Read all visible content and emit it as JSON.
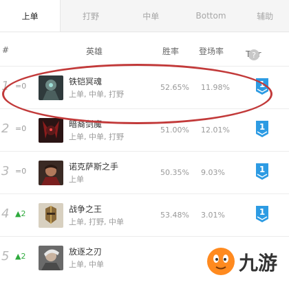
{
  "tabs": [
    {
      "label": "上单",
      "active": true
    },
    {
      "label": "打野",
      "active": false
    },
    {
      "label": "中单",
      "active": false
    },
    {
      "label": "Bottom",
      "active": false
    },
    {
      "label": "辅助",
      "active": false
    }
  ],
  "header": {
    "rank": "#",
    "hero": "英雄",
    "win": "胜率",
    "play": "登场率",
    "tier": "Tier",
    "help": "?"
  },
  "rows": [
    {
      "rank": "1",
      "change": "=0",
      "change_dir": "same",
      "name": "铁铠冥魂",
      "roles": "上单, 中单, 打野",
      "win": "52.65%",
      "play": "11.98%",
      "tier": "1"
    },
    {
      "rank": "2",
      "change": "=0",
      "change_dir": "same",
      "name": "暗裔剑魔",
      "roles": "上单, 中单, 打野",
      "win": "51.00%",
      "play": "12.01%",
      "tier": "1"
    },
    {
      "rank": "3",
      "change": "=0",
      "change_dir": "same",
      "name": "诺克萨斯之手",
      "roles": "上单",
      "win": "50.35%",
      "play": "9.03%",
      "tier": "1"
    },
    {
      "rank": "4",
      "change": "▲2",
      "change_dir": "up",
      "name": "战争之王",
      "roles": "上单, 打野, 中单",
      "win": "53.48%",
      "play": "3.01%",
      "tier": "1"
    },
    {
      "rank": "5",
      "change": "▲2",
      "change_dir": "up",
      "name": "放逐之刃",
      "roles": "上单, 中单",
      "win": "",
      "play": "",
      "tier": ""
    }
  ],
  "colors": {
    "tier_badge": "#2d9be3",
    "highlight_oval": "#c23a3a",
    "up": "#2eaa3d"
  },
  "watermark": {
    "text": "九游"
  }
}
